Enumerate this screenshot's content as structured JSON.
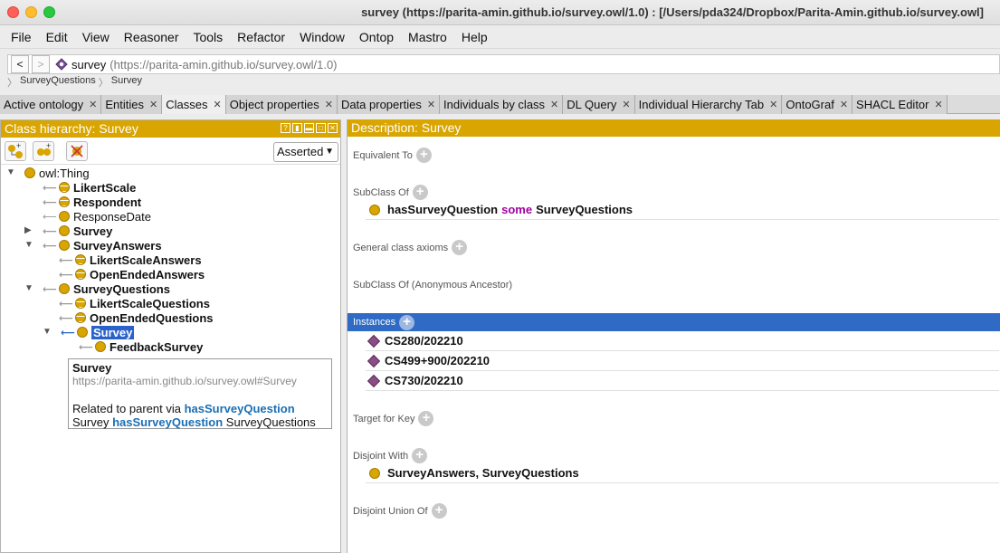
{
  "window": {
    "title": "survey (https://parita-amin.github.io/survey.owl/1.0)  : [/Users/pda324/Dropbox/Parita-Amin.github.io/survey.owl]"
  },
  "menu": [
    "File",
    "Edit",
    "View",
    "Reasoner",
    "Tools",
    "Refactor",
    "Window",
    "Ontop",
    "Mastro",
    "Help"
  ],
  "address": {
    "back": "<",
    "forward": ">",
    "name": "survey",
    "iri": "(https://parita-amin.github.io/survey.owl/1.0)"
  },
  "breadcrumb": [
    "SurveyQuestions",
    "Survey"
  ],
  "tabs": [
    {
      "label": "Active ontology",
      "active": false
    },
    {
      "label": "Entities",
      "active": false
    },
    {
      "label": "Classes",
      "active": true
    },
    {
      "label": "Object properties",
      "active": false
    },
    {
      "label": "Data properties",
      "active": false
    },
    {
      "label": "Individuals by class",
      "active": false
    },
    {
      "label": "DL Query",
      "active": false
    },
    {
      "label": "Individual Hierarchy Tab",
      "active": false
    },
    {
      "label": "OntoGraf",
      "active": false
    },
    {
      "label": "SHACL Editor",
      "active": false
    }
  ],
  "left": {
    "title": "Class hierarchy: Survey",
    "mode": "Asserted",
    "tree": [
      {
        "label": "owl:Thing",
        "bold": false
      },
      {
        "label": "LikertScale",
        "bold": true
      },
      {
        "label": "Respondent",
        "bold": true
      },
      {
        "label": "ResponseDate",
        "bold": false
      },
      {
        "label": "Survey",
        "bold": true
      },
      {
        "label": "SurveyAnswers",
        "bold": true
      },
      {
        "label": "LikertScaleAnswers",
        "bold": true
      },
      {
        "label": "OpenEndedAnswers",
        "bold": true
      },
      {
        "label": "SurveyQuestions",
        "bold": true
      },
      {
        "label": "LikertScaleQuestions",
        "bold": true
      },
      {
        "label": "OpenEndedQuestions",
        "bold": true
      },
      {
        "label": "Survey",
        "bold": true,
        "selected": true
      },
      {
        "label": "FeedbackSurvey",
        "bold": true
      }
    ],
    "tooltip": {
      "name": "Survey",
      "iri": "https://parita-amin.github.io/survey.owl#Survey",
      "related_prefix": "Related to parent via ",
      "property": "hasSurveyQuestion",
      "expr_subject": "Survey ",
      "expr_property": "hasSurveyQuestion",
      "expr_object": " SurveyQuestions"
    }
  },
  "right": {
    "title": "Description: Survey",
    "equivalent_to": "Equivalent To",
    "subclass_of": "SubClass Of",
    "subclass_expr": {
      "property": "hasSurveyQuestion",
      "keyword": "some",
      "filler": "SurveyQuestions"
    },
    "general_axioms": "General class axioms",
    "anon_ancestor": "SubClass Of (Anonymous Ancestor)",
    "instances_label": "Instances",
    "instances": [
      "CS280/202210",
      "CS499+900/202210",
      "CS730/202210"
    ],
    "target_for_key": "Target for Key",
    "disjoint_with": "Disjoint With",
    "disjoint_value": "SurveyAnswers, SurveyQuestions",
    "disjoint_union": "Disjoint Union Of"
  },
  "colors": {
    "header": "#d9a500",
    "selection": "#2a62c9",
    "keyword": "#a200a2",
    "individual": "#8a4e86"
  }
}
